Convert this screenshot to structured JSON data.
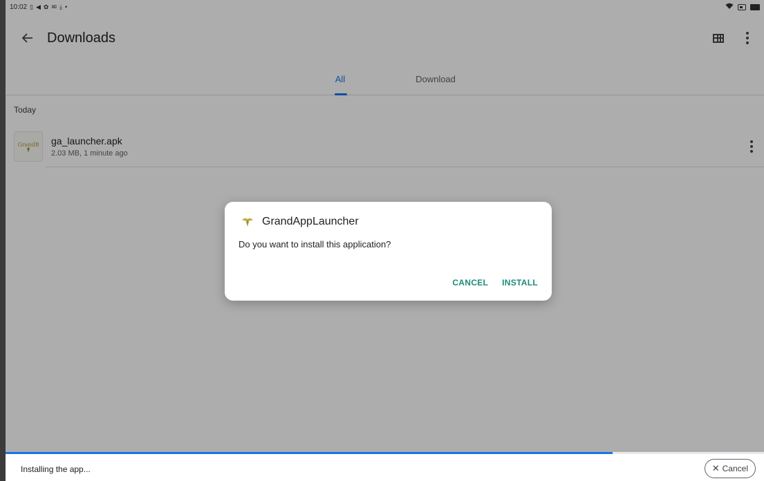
{
  "status_bar": {
    "time": "10:02",
    "left_icons": [
      "vibrate-icon",
      "send-icon",
      "settings-icon",
      "mail-icon",
      "download-icon",
      "dot-icon"
    ],
    "right_icons": [
      "wifi-icon",
      "battery-saver-icon",
      "battery-icon"
    ]
  },
  "app_bar": {
    "title": "Downloads",
    "back_icon": "arrow-left-icon",
    "actions": [
      "grid-view-icon",
      "more-vert-icon"
    ]
  },
  "tabs": [
    {
      "label": "All",
      "active": true
    },
    {
      "label": "Download",
      "active": false
    }
  ],
  "list": {
    "section": "Today",
    "items": [
      {
        "name": "ga_launcher.apk",
        "meta": "2.03 MB, 1 minute ago",
        "thumb_text": "GrandB"
      }
    ]
  },
  "dialog": {
    "title": "GrandAppLauncher",
    "message": "Do you want to install this application?",
    "cancel_label": "CANCEL",
    "install_label": "INSTALL"
  },
  "bottom_bar": {
    "status": "Installing the app...",
    "cancel_label": "Cancel",
    "progress": 0.8
  },
  "colors": {
    "accent": "#1a73e8",
    "dialog_action": "#1e8a7a",
    "scrim": "rgba(0,0,0,0.32)"
  }
}
